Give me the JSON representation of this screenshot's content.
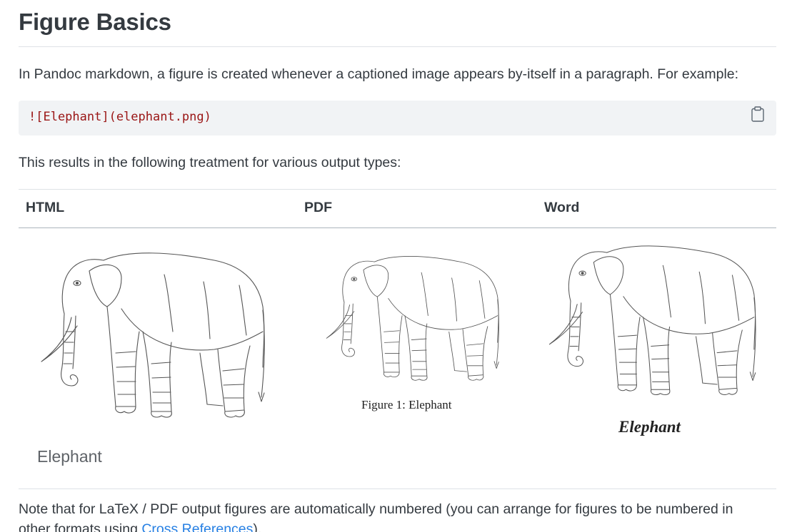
{
  "heading": "Figure Basics",
  "intro": "In Pandoc markdown, a figure is created whenever a captioned image appears by-itself in a paragraph. For example:",
  "code": {
    "text": "![Elephant](elephant.png)",
    "copy_icon": "clipboard-icon"
  },
  "treatment": "This results in the following treatment for various output types:",
  "table": {
    "headers": [
      "HTML",
      "PDF",
      "Word"
    ],
    "captions": {
      "html": "Elephant",
      "pdf": "Figure 1:  Elephant",
      "word": "Elephant"
    }
  },
  "note": {
    "line1": "Note that for LaTeX / PDF output figures are automatically numbered (you can arrange for figures to be numbered in",
    "line2_prefix": "other formats using ",
    "link": "Cross References",
    "line2_suffix": ")."
  },
  "colors": {
    "text": "#343a40",
    "code_bg": "#f1f3f5",
    "code_text": "#9a1515",
    "link": "#2780e3"
  }
}
